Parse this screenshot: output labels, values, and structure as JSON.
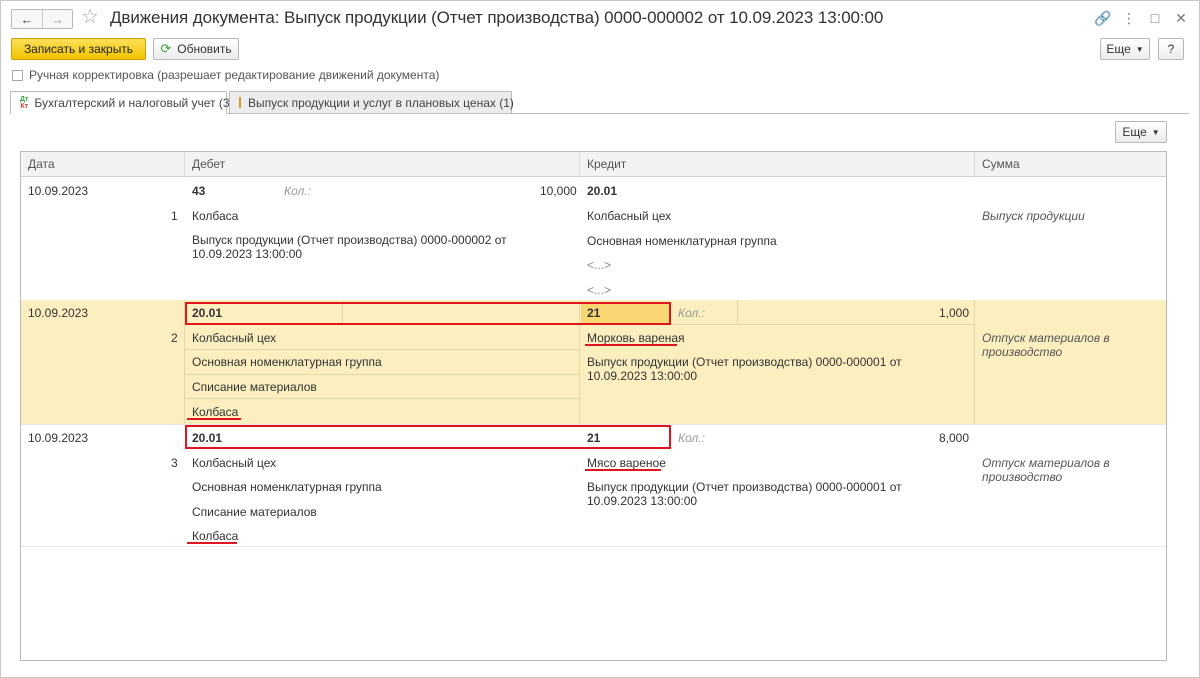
{
  "window": {
    "title": "Движения документа: Выпуск продукции (Отчет производства) 0000-000002 от 10.09.2023 13:00:00"
  },
  "toolbar": {
    "save_close_label": "Записать и закрыть",
    "refresh_label": "Обновить",
    "more_label": "Еще",
    "help_label": "?"
  },
  "manual_correction": "Ручная корректировка (разрешает редактирование движений документа)",
  "tabs": [
    {
      "label": "Бухгалтерский и налоговый учет (3)"
    },
    {
      "label": "Выпуск продукции и услуг в плановых ценах (1)"
    }
  ],
  "table_more_label": "Еще",
  "columns": {
    "date": "Дата",
    "debit": "Дебет",
    "credit": "Кредит",
    "sum": "Сумма"
  },
  "qty_label": "Кол.:",
  "rows": [
    {
      "date": "10.09.2023",
      "num": "1",
      "debit_account": "43",
      "debit_qty": "10,000",
      "debit_sub": [
        "Колбаса",
        "Выпуск продукции (Отчет производства) 0000-000002 от 10.09.2023 13:00:00"
      ],
      "credit_account": "20.01",
      "credit_qty": "",
      "credit_sub": [
        "Колбасный цех",
        "Основная номенклатурная группа",
        "<...>",
        "<...>"
      ],
      "sum": "",
      "content": "Выпуск продукции"
    },
    {
      "date": "10.09.2023",
      "num": "2",
      "debit_account": "20.01",
      "debit_qty": "",
      "debit_sub": [
        "Колбасный цех",
        "Основная номенклатурная группа",
        "Списание материалов",
        "Колбаса"
      ],
      "credit_account": "21",
      "credit_qty": "1,000",
      "credit_sub": [
        "Морковь вареная",
        "Выпуск продукции (Отчет производства) 0000-000001 от 10.09.2023 13:00:00"
      ],
      "sum": "",
      "content": "Отпуск материалов в производство"
    },
    {
      "date": "10.09.2023",
      "num": "3",
      "debit_account": "20.01",
      "debit_qty": "",
      "debit_sub": [
        "Колбасный цех",
        "Основная номенклатурная группа",
        "Списание материалов",
        "Колбаса"
      ],
      "credit_account": "21",
      "credit_qty": "8,000",
      "credit_sub": [
        "Мясо вареное",
        "Выпуск продукции (Отчет производства) 0000-000001 от 10.09.2023 13:00:00"
      ],
      "sum": "",
      "content": "Отпуск материалов в производство"
    }
  ],
  "colors": {
    "primary_button": "#f3c300",
    "highlight_row": "#fbefbf",
    "annotation": "#e0161e"
  }
}
